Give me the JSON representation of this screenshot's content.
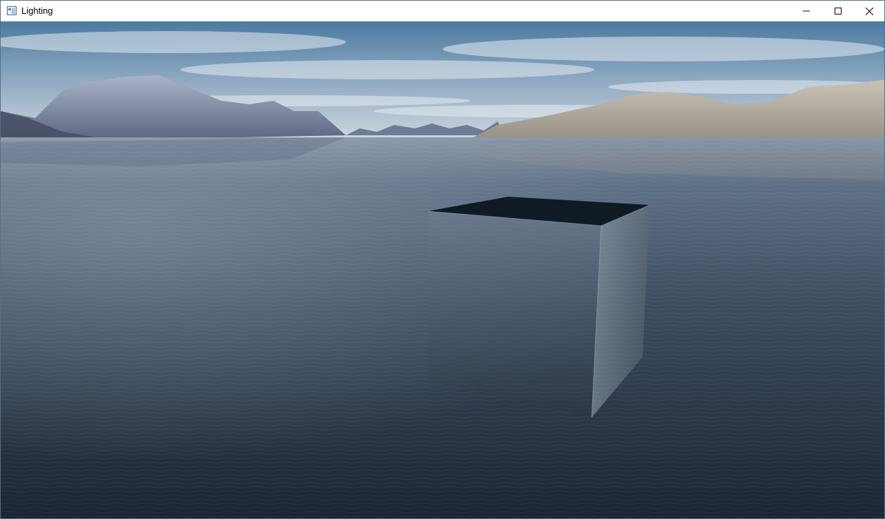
{
  "window": {
    "title": "Lighting",
    "app_icon": "app-window-icon",
    "controls": {
      "minimize": "minimize-icon",
      "maximize": "maximize-icon",
      "close": "close-icon"
    }
  },
  "scene": {
    "skybox": "sky-with-clouds-and-mountains",
    "ground": "ocean-water",
    "object": "reflective-cube",
    "colors": {
      "sky_top": "#4f7fa6",
      "sky_horizon": "#c9d3dc",
      "water_far": "#7b8fa3",
      "water_near": "#1d2736",
      "mountain_left": "#7d88a6",
      "mountain_right": "#b9b2a5",
      "cube_top": "#0f1a24"
    }
  }
}
